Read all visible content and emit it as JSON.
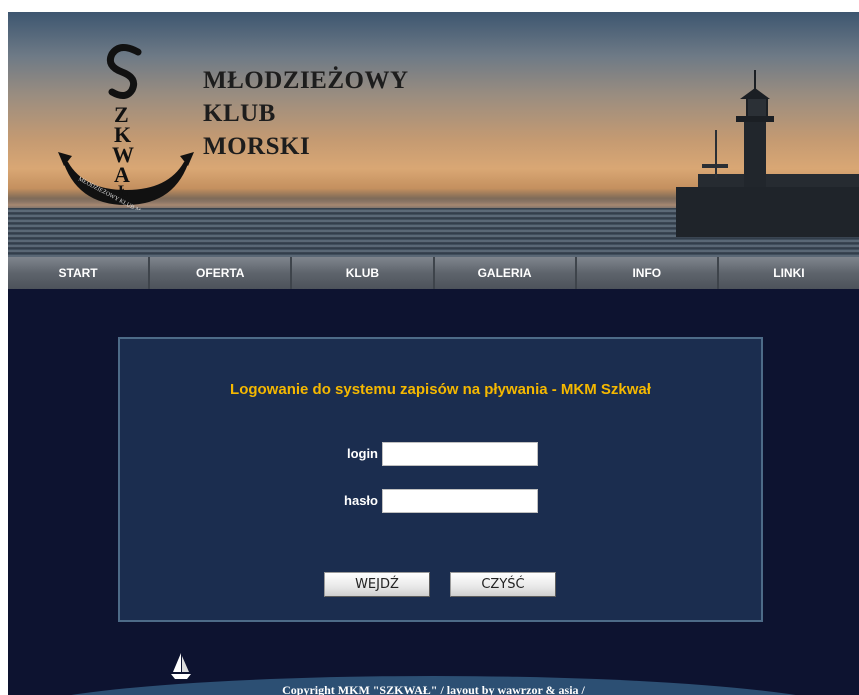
{
  "header": {
    "club_name_line1": "MŁODZIEŻOWY",
    "club_name_line2": "KLUB",
    "club_name_line3": "MORSKI",
    "logo_text": "SZKWAŁ",
    "logo_ring_text": "MŁODZIEŻOWY KLUB MORSKI"
  },
  "nav": {
    "items": [
      {
        "label": "START"
      },
      {
        "label": "OFERTA"
      },
      {
        "label": "KLUB"
      },
      {
        "label": "GALERIA"
      },
      {
        "label": "INFO"
      },
      {
        "label": "LINKI"
      }
    ]
  },
  "login": {
    "title": "Logowanie do systemu zapisów na pływania - MKM Szkwał",
    "login_label": "login",
    "login_value": "",
    "password_label": "hasło",
    "password_value": "",
    "submit_label": "WEJDŹ",
    "reset_label": "CZYŚĆ"
  },
  "footer": {
    "copyright": "Copyright MKM \"SZKWAŁ\" / layout by wawrzor & asia /"
  },
  "colors": {
    "page_bg": "#0d1330",
    "panel_bg": "#1b2d4f",
    "title_accent": "#f5b800",
    "nav_bg": "#5e646c"
  },
  "icons": {
    "logo": "anchor-logo-icon",
    "lighthouse": "lighthouse-icon",
    "sailboat": "sailboat-icon"
  }
}
